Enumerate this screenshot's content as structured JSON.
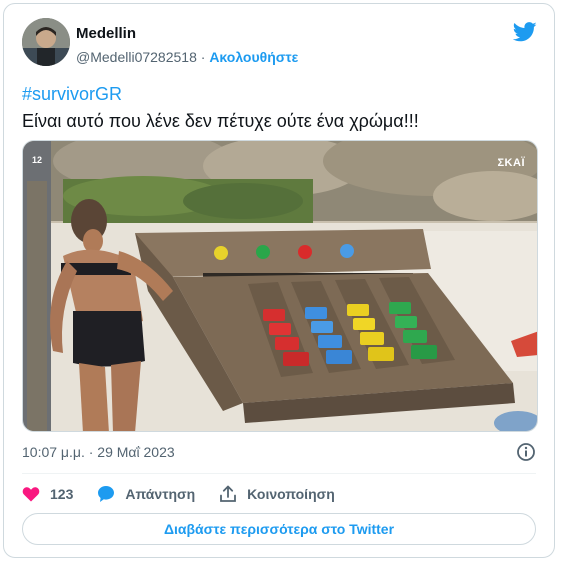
{
  "author": {
    "name": "Medellin",
    "handle": "@Medelli07282518",
    "separator": " · ",
    "follow_label": "Ακολουθήστε"
  },
  "icons": {
    "brand": "twitter-bird-icon",
    "like": "heart-icon",
    "reply": "speech-bubble-icon",
    "share": "share-upload-icon",
    "info": "info-icon"
  },
  "tweet": {
    "hashtag": "#survivorGR",
    "text": "Είναι αυτό που λένε δεν πέτυχε ούτε ένα χρώμα!!!"
  },
  "media": {
    "channel_overlay": "12",
    "broadcaster_logo": "ΣΚΑΪ"
  },
  "timestamp": "10:07 μ.μ. · 29 Μαΐ 2023",
  "actions": {
    "like_count": "123",
    "reply_label": "Απάντηση",
    "share_label": "Κοινοποίηση"
  },
  "read_more_label": "Διαβάστε περισσότερα στο Twitter",
  "colors": {
    "accent": "#1d9bf0",
    "like": "#f91880",
    "text": "#0f1419",
    "muted": "#536471"
  }
}
